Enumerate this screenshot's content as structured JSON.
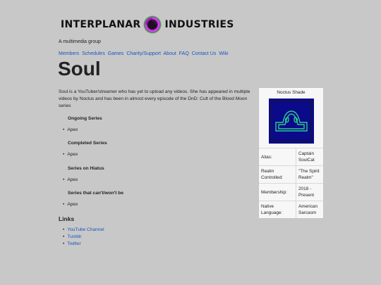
{
  "header": {
    "brand_left": "INTERPLANAR",
    "brand_right": "INDUSTRIES",
    "tagline": "A multimedia group"
  },
  "nav": [
    "Members",
    "Schedules",
    "Games",
    "Charity/Support",
    "About",
    "FAQ",
    "Contact Us",
    "Wiki"
  ],
  "page": {
    "title": "Soul",
    "intro": "Soul is a YouTuber/streamer who has yet to upload any videos. She has appeared in multiple videos by Noctus and has been in almost every episode of the DnD: Cult of the Blood Moon series",
    "sections": [
      {
        "heading": "Ongoing Series",
        "items": [
          "Apex"
        ]
      },
      {
        "heading": "Completed Series",
        "items": [
          "Apex"
        ]
      },
      {
        "heading": "Series on Hiatus",
        "items": [
          "Apex"
        ]
      },
      {
        "heading": "Series that can't/won't be",
        "items": [
          "Apex"
        ]
      }
    ],
    "links_heading": "Links",
    "links": [
      "YouTube Channel",
      "Tumblr",
      "Twitter"
    ]
  },
  "infobox": {
    "title": "Noctus Shade",
    "rows": [
      {
        "key": "Alias:",
        "value": "Captain SoulCat"
      },
      {
        "key": "Realm Controlled:",
        "value": "\"The Spirit Realm\""
      },
      {
        "key": "Membership:",
        "value": "2018 - Present"
      },
      {
        "key": "Native Language:",
        "value": "American Sarcasm"
      }
    ]
  },
  "colors": {
    "background": "#c8c8c8",
    "link": "#1a55c0",
    "emblem_bg": "#0a0a8a",
    "emblem_line": "#2ecc8a"
  }
}
